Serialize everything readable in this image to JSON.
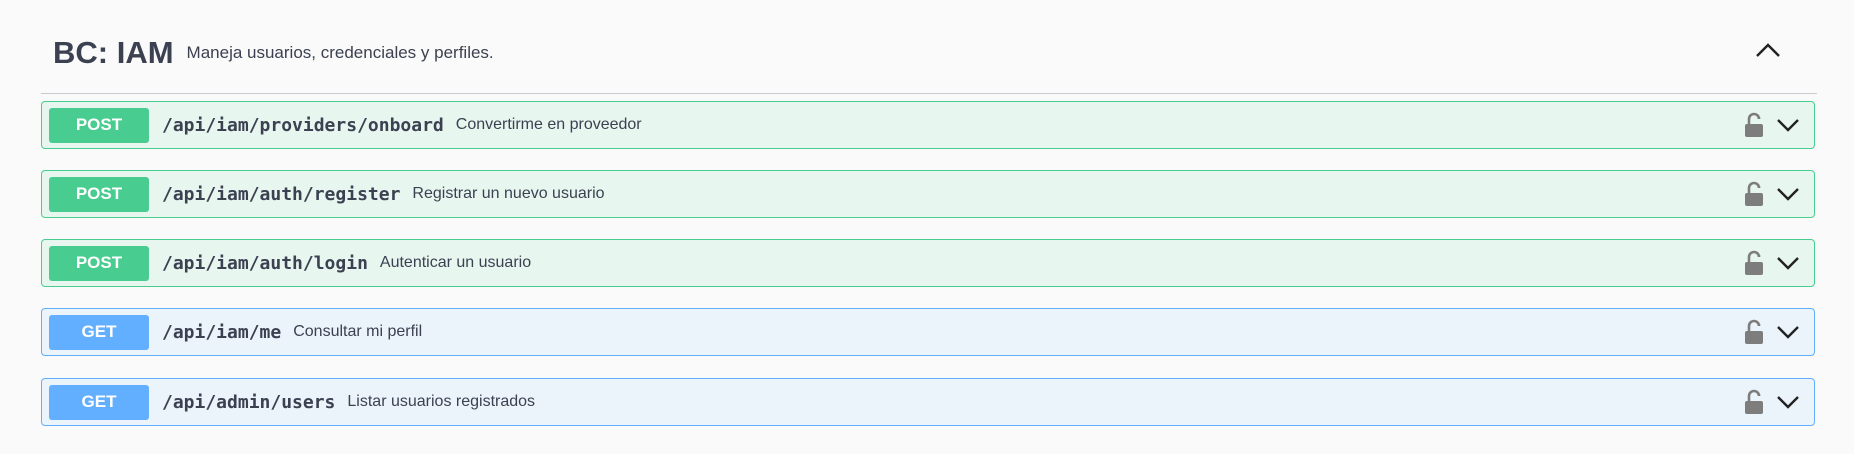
{
  "tag": {
    "title": "BC: IAM",
    "description": "Maneja usuarios, credenciales y perfiles."
  },
  "colors": {
    "post": "#49cc90",
    "get": "#61affe",
    "text": "#3b4151"
  },
  "operations": [
    {
      "method": "POST",
      "path": "/api/iam/providers/onboard",
      "summary": "Convertirme en proveedor"
    },
    {
      "method": "POST",
      "path": "/api/iam/auth/register",
      "summary": "Registrar un nuevo usuario"
    },
    {
      "method": "POST",
      "path": "/api/iam/auth/login",
      "summary": "Autenticar un usuario"
    },
    {
      "method": "GET",
      "path": "/api/iam/me",
      "summary": "Consultar mi perfil"
    },
    {
      "method": "GET",
      "path": "/api/admin/users",
      "summary": "Listar usuarios registrados"
    }
  ],
  "icons": {
    "collapse": "chevron-up-icon",
    "lock": "lock-icon",
    "expand": "chevron-down-icon"
  }
}
